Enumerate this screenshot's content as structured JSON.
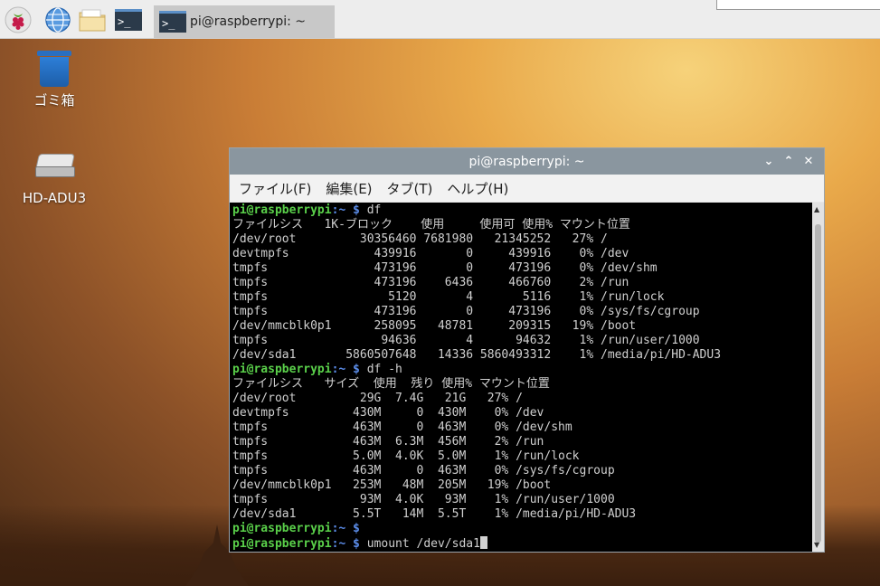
{
  "taskbar": {
    "active_task_label": "pi@raspberrypi: ~",
    "terminal_glyph": ">_"
  },
  "desktop": {
    "trash_label": "ゴミ箱",
    "drive_label": "HD-ADU3"
  },
  "window": {
    "title": "pi@raspberrypi: ~",
    "menu": [
      "ファイル(F)",
      "編集(E)",
      "タブ(T)",
      "ヘルプ(H)"
    ]
  },
  "terminal": {
    "user_host": "pi@raspberrypi",
    "path_sep": ":~ $ ",
    "lines": [
      {
        "type": "prompt",
        "cmd": "df"
      },
      {
        "type": "out",
        "text": "ファイルシス   1K-ブロック    使用     使用可 使用% マウント位置"
      },
      {
        "type": "out",
        "text": "/dev/root         30356460 7681980   21345252   27% /"
      },
      {
        "type": "out",
        "text": "devtmpfs            439916       0     439916    0% /dev"
      },
      {
        "type": "out",
        "text": "tmpfs               473196       0     473196    0% /dev/shm"
      },
      {
        "type": "out",
        "text": "tmpfs               473196    6436     466760    2% /run"
      },
      {
        "type": "out",
        "text": "tmpfs                 5120       4       5116    1% /run/lock"
      },
      {
        "type": "out",
        "text": "tmpfs               473196       0     473196    0% /sys/fs/cgroup"
      },
      {
        "type": "out",
        "text": "/dev/mmcblk0p1      258095   48781     209315   19% /boot"
      },
      {
        "type": "out",
        "text": "tmpfs                94636       4      94632    1% /run/user/1000"
      },
      {
        "type": "out",
        "text": "/dev/sda1       5860507648   14336 5860493312    1% /media/pi/HD-ADU3"
      },
      {
        "type": "prompt",
        "cmd": "df -h"
      },
      {
        "type": "out",
        "text": "ファイルシス   サイズ  使用  残り 使用% マウント位置"
      },
      {
        "type": "out",
        "text": "/dev/root         29G  7.4G   21G   27% /"
      },
      {
        "type": "out",
        "text": "devtmpfs         430M     0  430M    0% /dev"
      },
      {
        "type": "out",
        "text": "tmpfs            463M     0  463M    0% /dev/shm"
      },
      {
        "type": "out",
        "text": "tmpfs            463M  6.3M  456M    2% /run"
      },
      {
        "type": "out",
        "text": "tmpfs            5.0M  4.0K  5.0M    1% /run/lock"
      },
      {
        "type": "out",
        "text": "tmpfs            463M     0  463M    0% /sys/fs/cgroup"
      },
      {
        "type": "out",
        "text": "/dev/mmcblk0p1   253M   48M  205M   19% /boot"
      },
      {
        "type": "out",
        "text": "tmpfs             93M  4.0K   93M    1% /run/user/1000"
      },
      {
        "type": "out",
        "text": "/dev/sda1        5.5T   14M  5.5T    1% /media/pi/HD-ADU3"
      },
      {
        "type": "prompt",
        "cmd": ""
      },
      {
        "type": "prompt",
        "cmd": "umount /dev/sda1",
        "cursor": true
      }
    ]
  }
}
